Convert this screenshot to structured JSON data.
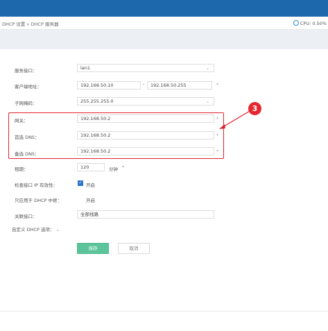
{
  "breadcrumb": "DHCP 设置 » DHCP 服务器",
  "cpu": "CPU: 0.50%",
  "form": {
    "interface": {
      "label": "服务接口：",
      "value": "lan1"
    },
    "client_range": {
      "label": "客户端地址：",
      "start": "192.168.50.10",
      "sep": "-",
      "end": "192.168.50.255",
      "required": "*"
    },
    "subnet_mask": {
      "label": "子网掩码：",
      "value": "255.255.255.0"
    },
    "gateway": {
      "label": "网关：",
      "value": "192.168.50.2",
      "required": "*"
    },
    "primary_dns": {
      "label": "首选 DNS：",
      "value": "192.168.50.2",
      "required": "*"
    },
    "secondary_dns": {
      "label": "备选 DNS：",
      "value": "192.168.50.2",
      "required": "*"
    },
    "lease": {
      "label": "租期：",
      "value": "120",
      "unit": "分钟",
      "required": "*"
    },
    "check_ip": {
      "label": "检查接口 IP 有效性：",
      "option": "开启",
      "checked": true
    },
    "dhcp_relay_only": {
      "label": "只应用于 DHCP 中继：",
      "option": "开启",
      "checked": false
    },
    "linked_interface": {
      "label": "关联接口：",
      "value": "全部线路"
    },
    "custom_options": {
      "label": "自定义 DHCP 选项："
    }
  },
  "buttons": {
    "save": "保存",
    "cancel": "取消"
  },
  "annotation": {
    "number": "3"
  },
  "colors": {
    "topbar": "#1d67ad",
    "highlight": "#e0212b",
    "save": "#5bc49a",
    "checkbox": "#2a73c9"
  }
}
